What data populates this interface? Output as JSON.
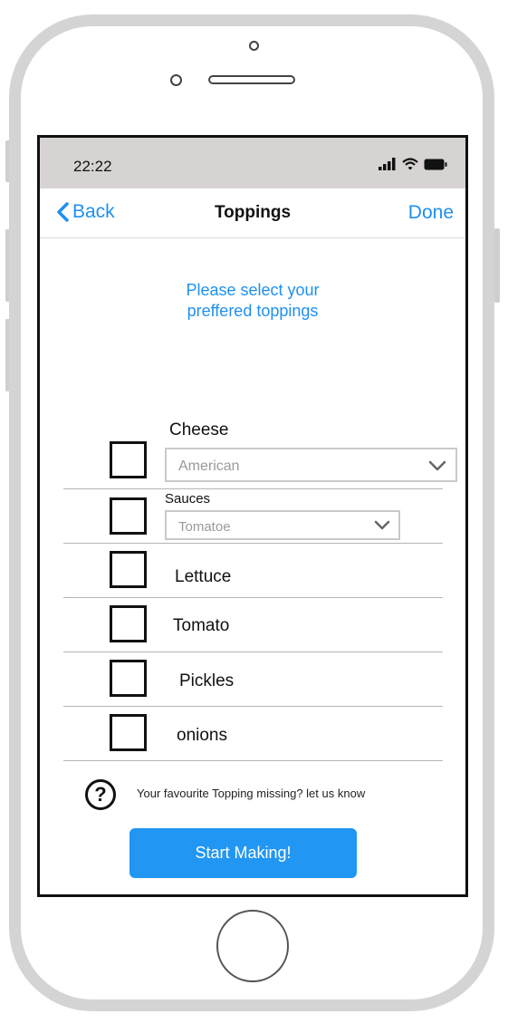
{
  "status_bar": {
    "time": "22:22",
    "icons": [
      "signal-icon",
      "wifi-icon",
      "battery-icon"
    ]
  },
  "nav": {
    "back_label": "Back",
    "title": "Toppings",
    "done_label": "Done"
  },
  "prompt": {
    "line1": "Please select your",
    "line2": "preffered toppings"
  },
  "toppings": {
    "cheese": {
      "label": "Cheese",
      "selected": "American"
    },
    "sauces": {
      "label": "Sauces",
      "selected": "Tomatoe"
    },
    "items": [
      "Lettuce",
      "Tomato",
      "Pickles",
      "onions"
    ]
  },
  "help": {
    "icon": "question-circle-icon",
    "text": "Your favourite Topping missing? let us know"
  },
  "cta": {
    "label": "Start Making!"
  },
  "colors": {
    "accent": "#1e90f0",
    "button": "#2196f3",
    "status_bar": "#d8d3d3",
    "frame": "#d4d4d4"
  }
}
